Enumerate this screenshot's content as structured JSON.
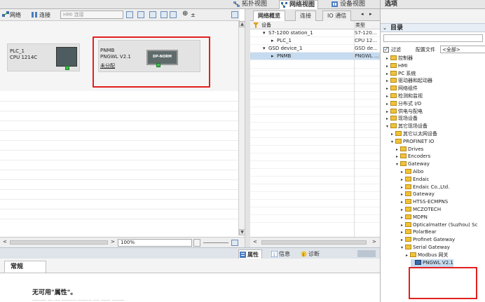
{
  "view_tabs": [
    {
      "label": "拓扑视图",
      "active": false
    },
    {
      "label": "网络视图",
      "active": true
    },
    {
      "label": "设备视图",
      "active": false
    }
  ],
  "options_title": "选项",
  "toolbar": {
    "network_label": "网络",
    "connect_label": "连接",
    "hmi_connection": "HMI 连接"
  },
  "devices": {
    "plc": {
      "name": "PLC_1",
      "type": "CPU 1214C"
    },
    "pnmb": {
      "name": "PNMB",
      "type": "PNGWL V2.1",
      "status": "未分配",
      "module_label": "DP-NORM"
    }
  },
  "bottom": {
    "zoom": "100%"
  },
  "overview": {
    "tabs": [
      "网络概览",
      "连接",
      "IO 通信"
    ],
    "col_device": "设备",
    "col_type": "类型",
    "rows": [
      {
        "name": "S7-1200 station_1",
        "type": "S7-120...",
        "level": 1
      },
      {
        "name": "PLC_1",
        "type": "CPU 12...",
        "level": 2
      },
      {
        "name": "GSD device_1",
        "type": "GSD de...",
        "level": 1
      },
      {
        "name": "PNMB",
        "type": "PNGWL ...",
        "level": 2
      }
    ]
  },
  "properties": {
    "tabs": [
      "属性",
      "信息",
      "诊断"
    ],
    "general_tab": "常规",
    "no_properties": "无可用\"属性\"。"
  },
  "options": {
    "catalog": "目录",
    "filter": "过滤",
    "profile_label": "配置文件",
    "profile_value": "<全部>",
    "tree": [
      {
        "label": "控制器",
        "level": 0,
        "open": false,
        "kind": "folder"
      },
      {
        "label": "HMI",
        "level": 0,
        "open": false,
        "kind": "folder"
      },
      {
        "label": "PC 系统",
        "level": 0,
        "open": false,
        "kind": "folder"
      },
      {
        "label": "驱动器和起动器",
        "level": 0,
        "open": false,
        "kind": "folder"
      },
      {
        "label": "网络组件",
        "level": 0,
        "open": false,
        "kind": "folder"
      },
      {
        "label": "检测和监视",
        "level": 0,
        "open": false,
        "kind": "folder"
      },
      {
        "label": "分布式 I/O",
        "level": 0,
        "open": false,
        "kind": "folder"
      },
      {
        "label": "供电与配电",
        "level": 0,
        "open": false,
        "kind": "folder"
      },
      {
        "label": "现场设备",
        "level": 0,
        "open": false,
        "kind": "folder"
      },
      {
        "label": "其它现场设备",
        "level": 0,
        "open": true,
        "kind": "folder"
      },
      {
        "label": "其它以太网设备",
        "level": 1,
        "open": false,
        "kind": "folder"
      },
      {
        "label": "PROFINET IO",
        "level": 1,
        "open": true,
        "kind": "folder"
      },
      {
        "label": "Drives",
        "level": 2,
        "open": false,
        "kind": "folder"
      },
      {
        "label": "Encoders",
        "level": 2,
        "open": false,
        "kind": "folder"
      },
      {
        "label": "Gateway",
        "level": 2,
        "open": true,
        "kind": "folder"
      },
      {
        "label": "Aibo",
        "level": 3,
        "open": false,
        "kind": "folder"
      },
      {
        "label": "Endaic",
        "level": 3,
        "open": false,
        "kind": "folder"
      },
      {
        "label": "Endaic Co.,Ltd.",
        "level": 3,
        "open": false,
        "kind": "folder"
      },
      {
        "label": "Gateway",
        "level": 3,
        "open": false,
        "kind": "folder"
      },
      {
        "label": "HTSS-ECMPNS",
        "level": 3,
        "open": false,
        "kind": "folder"
      },
      {
        "label": "MCZOTECH",
        "level": 3,
        "open": false,
        "kind": "folder"
      },
      {
        "label": "MDPN",
        "level": 3,
        "open": false,
        "kind": "folder"
      },
      {
        "label": "Opticalmatter (Suzhou) Sc",
        "level": 3,
        "open": false,
        "kind": "folder"
      },
      {
        "label": "PolarBear",
        "level": 3,
        "open": false,
        "kind": "folder"
      },
      {
        "label": "Profinet Gateway",
        "level": 3,
        "open": false,
        "kind": "folder"
      },
      {
        "label": "Serial Gateway",
        "level": 3,
        "open": true,
        "kind": "folder"
      },
      {
        "label": "Modbus 网关",
        "level": 4,
        "open": false,
        "kind": "folder"
      },
      {
        "label": "PNGWL V2.1",
        "level": 5,
        "open": false,
        "kind": "device"
      }
    ]
  },
  "colors": {
    "highlight_red": "#e2201f",
    "selection": "#c6dbf0",
    "link_blue": "#2151c9"
  }
}
